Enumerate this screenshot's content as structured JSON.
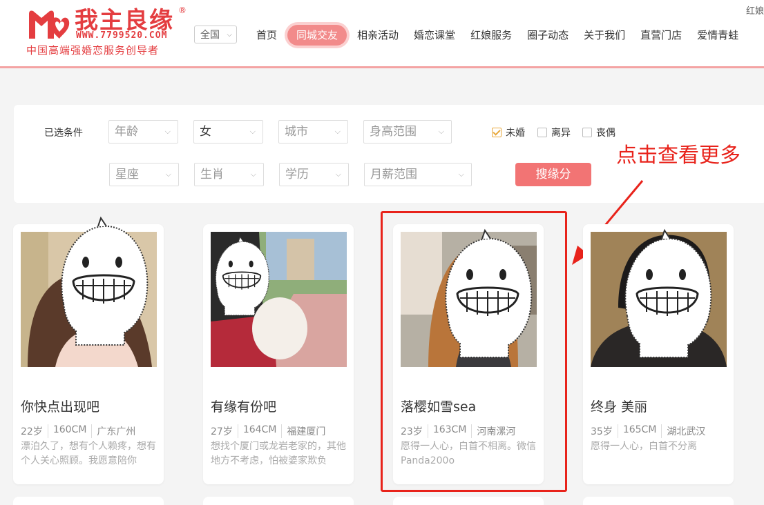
{
  "topright": "红娘",
  "logo": {
    "name": "我主良缘",
    "reg": "®",
    "url": "WWW.7799520.COM",
    "slogan": "中国高端强婚恋服务创导者"
  },
  "region": "全国",
  "nav": [
    "首页",
    "同城交友",
    "相亲活动",
    "婚恋课堂",
    "红娘服务",
    "圈子动态",
    "关于我们",
    "直营门店",
    "爱情青蛙"
  ],
  "filter": {
    "label": "已选条件",
    "row1": [
      "年龄",
      "女",
      "城市",
      "身高范围"
    ],
    "row2": [
      "星座",
      "生肖",
      "学历",
      "月薪范围"
    ],
    "checkboxes": [
      {
        "label": "未婚",
        "checked": true
      },
      {
        "label": "离异",
        "checked": false
      },
      {
        "label": "丧偶",
        "checked": false
      }
    ],
    "search_button": "搜缘分"
  },
  "annotation": "点击查看更多",
  "cards": [
    {
      "name": "你快点出现吧",
      "age": "22岁",
      "height": "160CM",
      "city": "广东广州",
      "bio": "漂泊久了，想有个人赖疼，想有个人关心照顾。我愿意陪你"
    },
    {
      "name": "有缘有份吧",
      "age": "27岁",
      "height": "164CM",
      "city": "福建厦门",
      "bio": "想找个厦门或龙岩老家的，其他地方不考虑，怕被婆家欺负"
    },
    {
      "name": "落樱如雪sea",
      "age": "23岁",
      "height": "163CM",
      "city": "河南漯河",
      "bio": "愿得一人心，白首不相离。微信Panda200o"
    },
    {
      "name": "终身 美丽",
      "age": "35岁",
      "height": "165CM",
      "city": "湖北武汉",
      "bio": "愿得一人心，白首不分离"
    }
  ],
  "colors": {
    "brand": "#e43d40",
    "nav_active": "#f28b8b",
    "button": "#f27474",
    "annotation": "#e8231b",
    "check": "#e8a83b"
  }
}
